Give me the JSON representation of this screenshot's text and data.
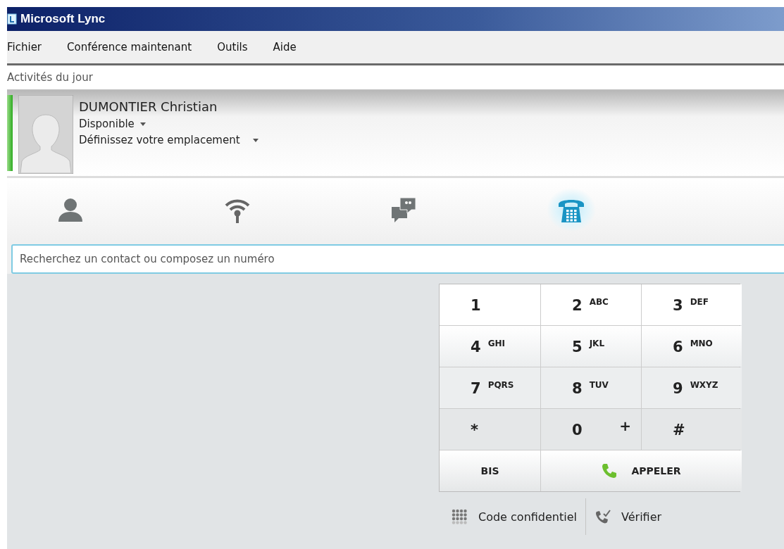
{
  "window": {
    "title": "Microsoft Lync"
  },
  "menu": [
    "Fichier",
    "Conférence maintenant",
    "Outils",
    "Aide"
  ],
  "activity_note": "Activités du jour",
  "profile": {
    "name": "DUMONTIER Christian",
    "status": "Disponible",
    "location": "Définissez votre emplacement"
  },
  "tabs": [
    {
      "kind": "contacts",
      "selected": false
    },
    {
      "kind": "feed",
      "selected": false
    },
    {
      "kind": "conversations",
      "selected": false
    },
    {
      "kind": "phone",
      "selected": true
    }
  ],
  "search": {
    "placeholder": "Recherchez un contact ou composez un numéro"
  },
  "dialpad": {
    "keys": [
      {
        "digit": "1"
      },
      {
        "digit": "2",
        "letters": "ABC"
      },
      {
        "digit": "3",
        "letters": "DEF"
      },
      {
        "digit": "4",
        "letters": "GHI"
      },
      {
        "digit": "5",
        "letters": "JKL"
      },
      {
        "digit": "6",
        "letters": "MNO"
      },
      {
        "digit": "7",
        "letters": "PQRS"
      },
      {
        "digit": "8",
        "letters": "TUV"
      },
      {
        "digit": "9",
        "letters": "WXYZ"
      },
      {
        "digit": "*",
        "kind": "symbol"
      },
      {
        "digit": "0",
        "letters": "+",
        "kind": "plus"
      },
      {
        "digit": "#",
        "kind": "symbol"
      }
    ],
    "redial": "BIS",
    "call": "APPELER"
  },
  "links": [
    {
      "kind": "pin",
      "label": "Code confidentiel"
    },
    {
      "kind": "check",
      "label": "Vérifier"
    }
  ]
}
